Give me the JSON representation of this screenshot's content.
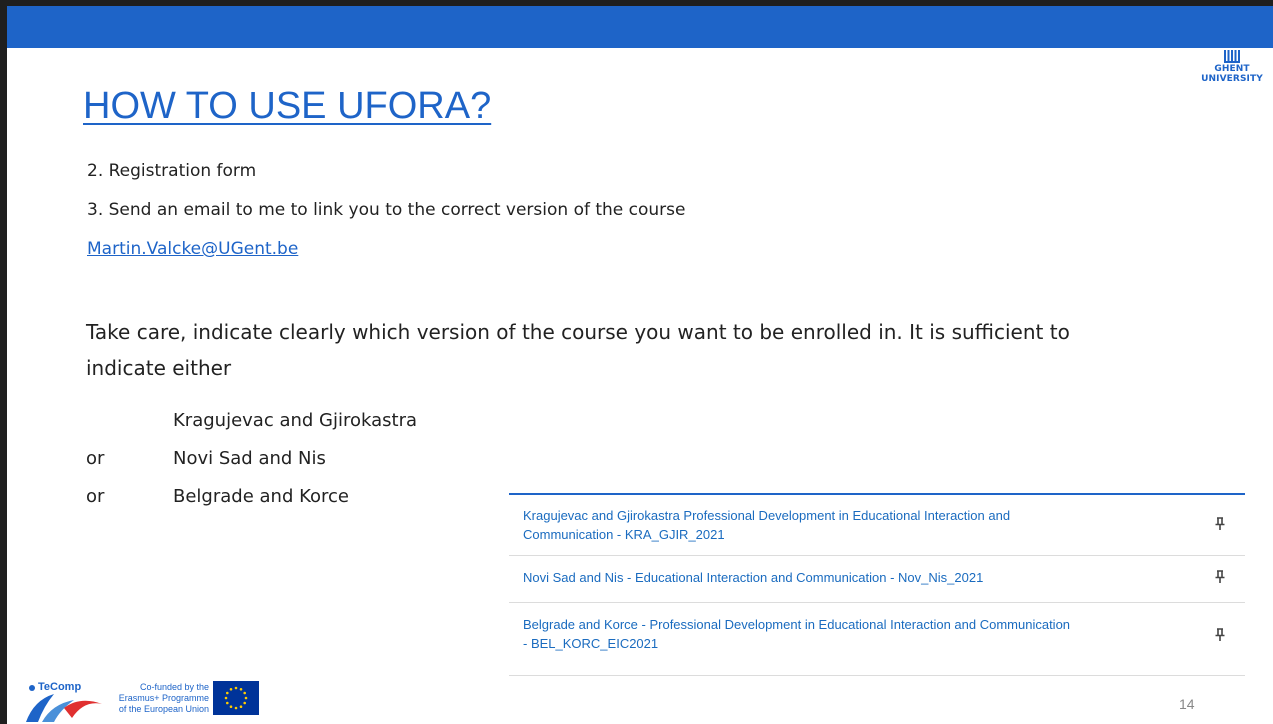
{
  "slide": {
    "title": "HOW TO USE UFORA?",
    "logo": {
      "line1": "GHENT",
      "line2": "UNIVERSITY"
    },
    "steps": [
      "2. Registration form",
      "3. Send an email to me to link you to the correct version of the course"
    ],
    "email": "Martin.Valcke@UGent.be",
    "instruction_line1": "Take care, indicate clearly which version  of the course you want to be enrolled in. It is sufficient to",
    "instruction_line2": "indicate either",
    "options": [
      {
        "prefix": "",
        "name": "Kragujevac and Gjirokastra"
      },
      {
        "prefix": "or",
        "name": "Novi Sad and Nis"
      },
      {
        "prefix": "or",
        "name": "Belgrade and Korce"
      }
    ],
    "courses": [
      {
        "line1": "Kragujevac and Gjirokastra Professional Development in Educational Interaction and",
        "line2": "Communication - KRA_GJIR_2021",
        "icon": "pin-icon"
      },
      {
        "line1": "Novi Sad and Nis - Educational Interaction and Communication - Nov_Nis_2021",
        "line2": "",
        "icon": "pin-icon"
      },
      {
        "line1": "Belgrade and Korce - Professional Development in Educational Interaction and Communication",
        "line2": "- BEL_KORC_EIC2021",
        "icon": "pin-icon"
      }
    ],
    "footer": {
      "project_logo_text": "TeComp",
      "cofunded_line1": "Co-funded by the",
      "cofunded_line2": "Erasmus+ Programme",
      "cofunded_line3": "of the European Union",
      "page_number": "14"
    },
    "colors": {
      "accent": "#1e64c8",
      "text": "#222222",
      "link": "#1a6bbf",
      "eu_blue": "#003399",
      "eu_star": "#ffcc00"
    }
  }
}
